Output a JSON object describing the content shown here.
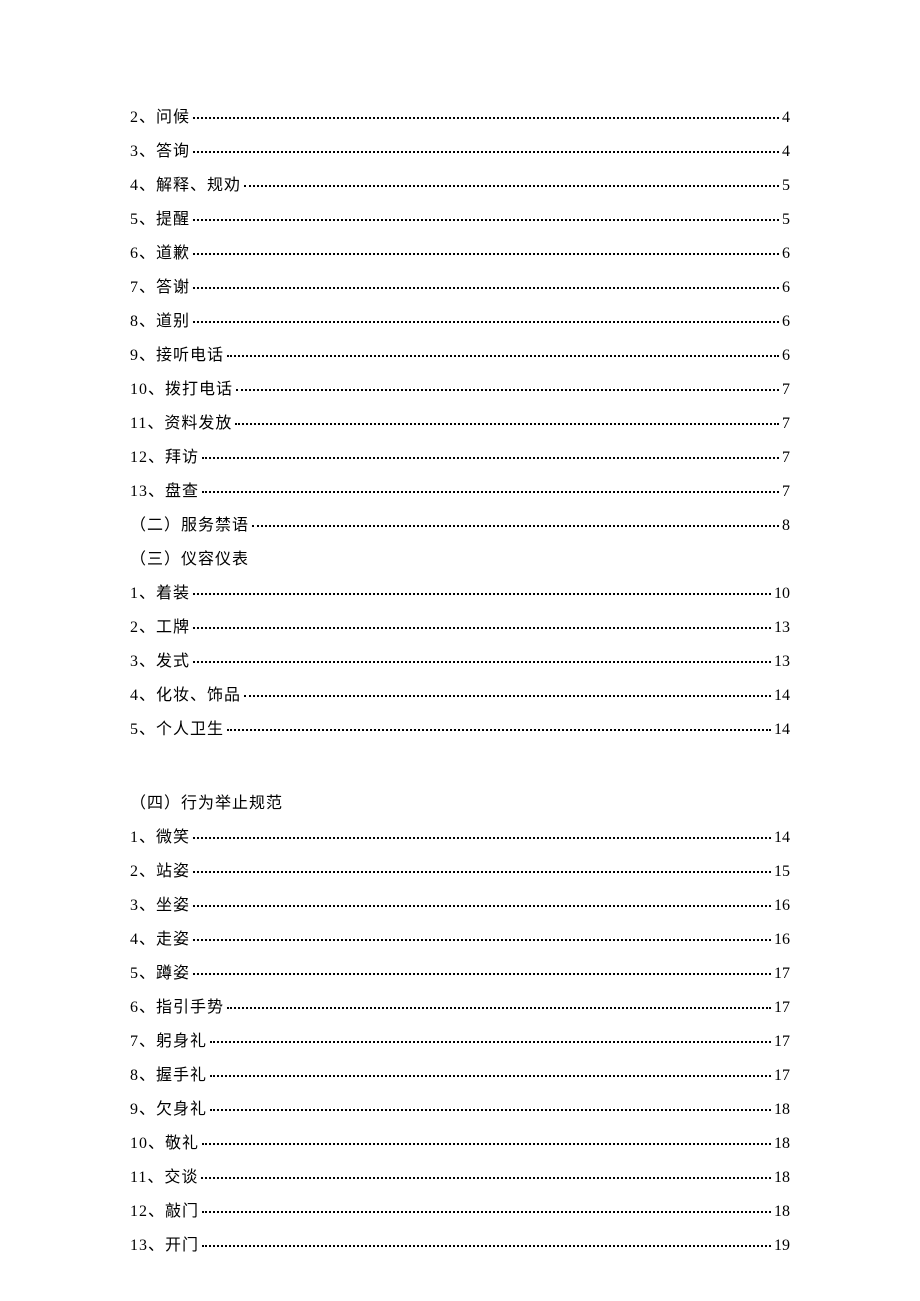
{
  "toc": [
    {
      "label": "2、问候",
      "page": "4",
      "kind": "item"
    },
    {
      "label": "3、答询",
      "page": "4",
      "kind": "item"
    },
    {
      "label": "4、解释、规劝",
      "page": "5",
      "kind": "item"
    },
    {
      "label": "5、提醒",
      "page": "5",
      "kind": "item"
    },
    {
      "label": "6、道歉",
      "page": "6",
      "kind": "item"
    },
    {
      "label": "7、答谢",
      "page": "6",
      "kind": "item"
    },
    {
      "label": "8、道别",
      "page": "6",
      "kind": "item"
    },
    {
      "label": "9、接听电话",
      "page": "6",
      "kind": "item"
    },
    {
      "label": "10、拨打电话",
      "page": "7",
      "kind": "item"
    },
    {
      "label": "11、资料发放",
      "page": "7",
      "kind": "item"
    },
    {
      "label": "12、拜访",
      "page": "7",
      "kind": "item"
    },
    {
      "label": "13、盘查",
      "page": "7",
      "kind": "item"
    },
    {
      "label": "（二）服务禁语",
      "page": "8",
      "kind": "section-dotted"
    },
    {
      "label": "（三）仪容仪表",
      "kind": "section-plain"
    },
    {
      "label": "1、着装",
      "page": "10",
      "kind": "item"
    },
    {
      "label": "2、工牌",
      "page": "13",
      "kind": "item"
    },
    {
      "label": "3、发式",
      "page": "13",
      "kind": "item"
    },
    {
      "label": "4、化妆、饰品",
      "page": "14",
      "kind": "item"
    },
    {
      "label": "5、个人卫生",
      "page": "14",
      "kind": "item"
    },
    {
      "kind": "gap"
    },
    {
      "label": "（四）行为举止规范",
      "kind": "section-plain"
    },
    {
      "label": "1、微笑",
      "page": "14",
      "kind": "item"
    },
    {
      "label": "2、站姿",
      "page": "15",
      "kind": "item"
    },
    {
      "label": "3、坐姿",
      "page": "16",
      "kind": "item"
    },
    {
      "label": "4、走姿",
      "page": "16",
      "kind": "item"
    },
    {
      "label": "5、蹲姿",
      "page": "17",
      "kind": "item"
    },
    {
      "label": "6、指引手势",
      "page": "17",
      "kind": "item"
    },
    {
      "label": "7、躬身礼",
      "page": "17",
      "kind": "item"
    },
    {
      "label": "8、握手礼",
      "page": "17",
      "kind": "item"
    },
    {
      "label": "9、欠身礼",
      "page": "18",
      "kind": "item"
    },
    {
      "label": "10、敬礼",
      "page": "18",
      "kind": "item"
    },
    {
      "label": "11、交谈",
      "page": "18",
      "kind": "item"
    },
    {
      "label": "12、敲门",
      "page": "18",
      "kind": "item"
    },
    {
      "label": "13、开门",
      "page": "19",
      "kind": "item"
    }
  ]
}
